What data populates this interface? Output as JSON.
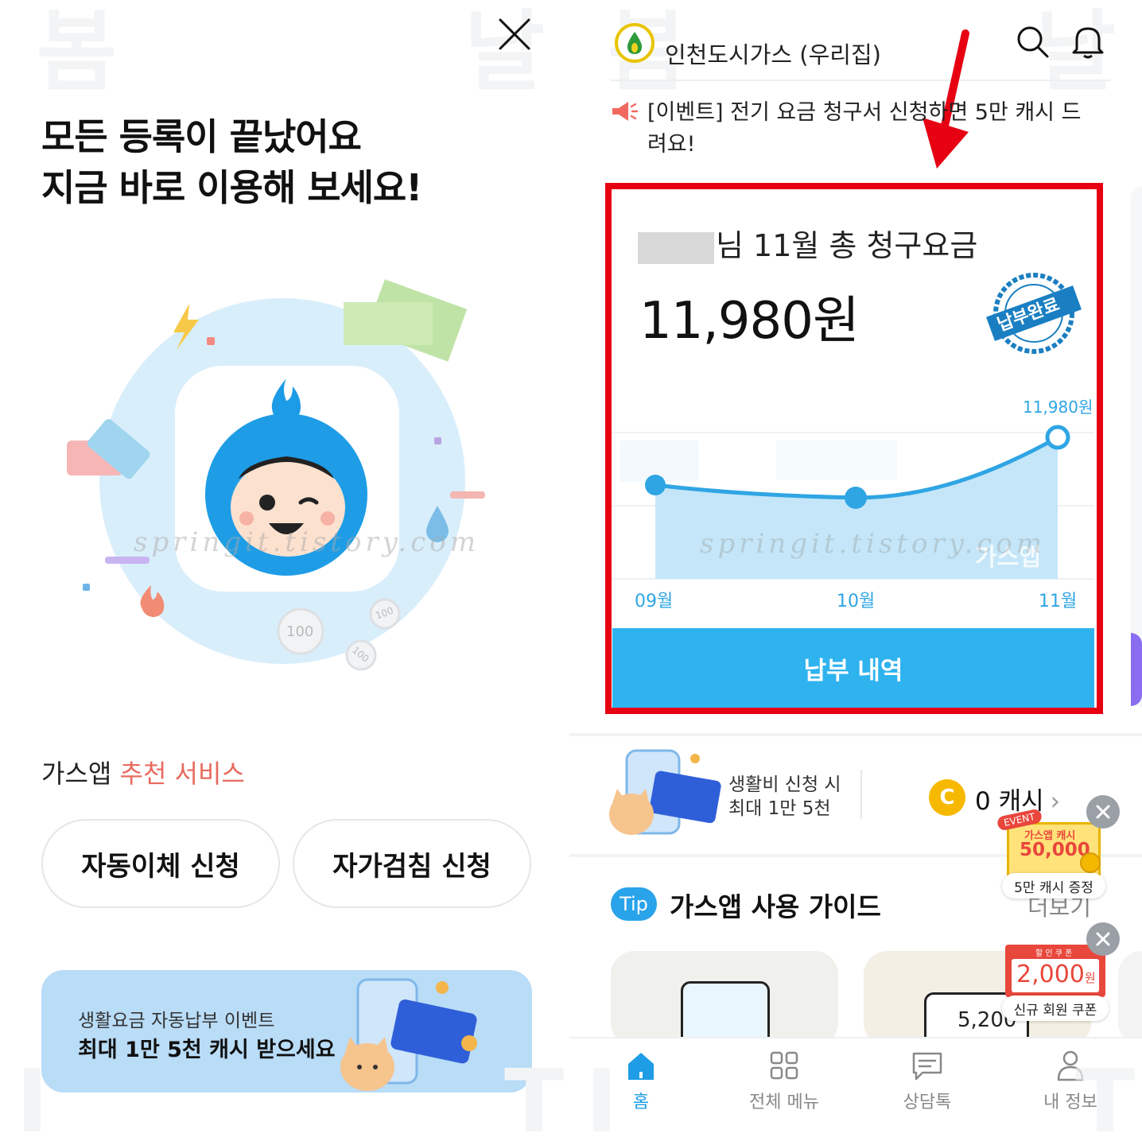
{
  "left": {
    "watermark_top": [
      "봄",
      "날"
    ],
    "headline_line1": "모든 등록이 끝났어요",
    "headline_line2": "지금 바로 이용해 보세요!",
    "watermark_site": "springit.tistory.com",
    "coins": [
      "100",
      "100",
      "100"
    ],
    "recommend_prefix": "가스앱",
    "recommend_highlight": "추천 서비스",
    "buttons": [
      "자동이체 신청",
      "자가검침 신청"
    ],
    "banner": {
      "line1": "생활요금 자동납부 이벤트",
      "line2": "최대 1만 5천 캐시 받으세요"
    }
  },
  "right": {
    "brand_name": "인천도시가스 (우리집)",
    "notice": "[이벤트] 전기 요금 청구서 신청하면 5만 캐시 드려요!",
    "bill": {
      "title_suffix": "님 11월 총 청구요금",
      "amount": "11,980원",
      "stamp": "납부완료",
      "pay_history_label": "납부 내역"
    },
    "chart_data": {
      "type": "area",
      "categories": [
        "09월",
        "10월",
        "11월"
      ],
      "values": [
        null,
        null,
        11980
      ],
      "value_label": "11,980원",
      "watermark": "가스앱"
    },
    "promo": {
      "line1": "생활비 신청 시",
      "line2": "최대 1만 5천",
      "cash": "0 캐시"
    },
    "float_event": {
      "tag": "EVENT",
      "title": "가스앱 캐시",
      "amount": "50,000",
      "caption": "5만 캐시 증정"
    },
    "float_coupon": {
      "tag": "할 인 쿠 폰",
      "amount": "2,000",
      "unit": "원",
      "caption": "신규 회원 쿠폰"
    },
    "guide": {
      "badge": "Tip",
      "title": "가스앱 사용 가이드",
      "more": "더보기",
      "card_value": "5,200"
    },
    "tabs": [
      "홈",
      "전체 메뉴",
      "상담톡",
      "내 정보"
    ],
    "colors": {
      "accent": "#2fb3ef",
      "highlight_frame": "#e60012",
      "arrow": "#e60012"
    }
  }
}
